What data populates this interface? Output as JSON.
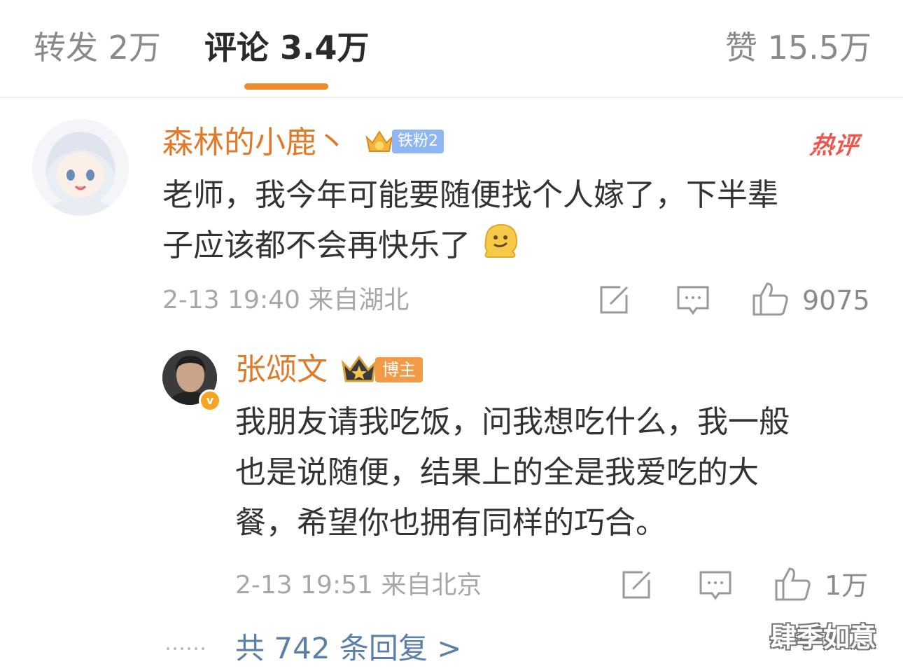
{
  "tabs": {
    "repost": "转发 2万",
    "comments": "评论 3.4万",
    "likes": "赞 15.5万"
  },
  "comment": {
    "username": "森林的小鹿丶",
    "fan_badge": "铁粉2",
    "hot_tag": "热评",
    "text_line1": "老师，我今年可能要随便找个人嫁了，下半辈",
    "text_line2": "子应该都不会再快乐了",
    "emoji": "melting-face-emoji",
    "meta": "2-13 19:40 来自湖北",
    "like_count": "9075"
  },
  "reply": {
    "username": "张颂文",
    "badge": "博主",
    "verify": "v",
    "text_line1": "我朋友请我吃饭，问我想吃什么，我一般",
    "text_line2": "也是说随便，结果上的全是我爱吃的大",
    "text_line3": "餐，希望你也拥有同样的巧合。",
    "meta": "2-13 19:51 来自北京",
    "like_count": "1万"
  },
  "more_replies": "共 742 条回复 >",
  "watermark": "肆季如意",
  "colors": {
    "accent": "#f08a2a",
    "username": "#e07a2a",
    "link": "#5a7fa8",
    "hot": "#f0554e"
  }
}
